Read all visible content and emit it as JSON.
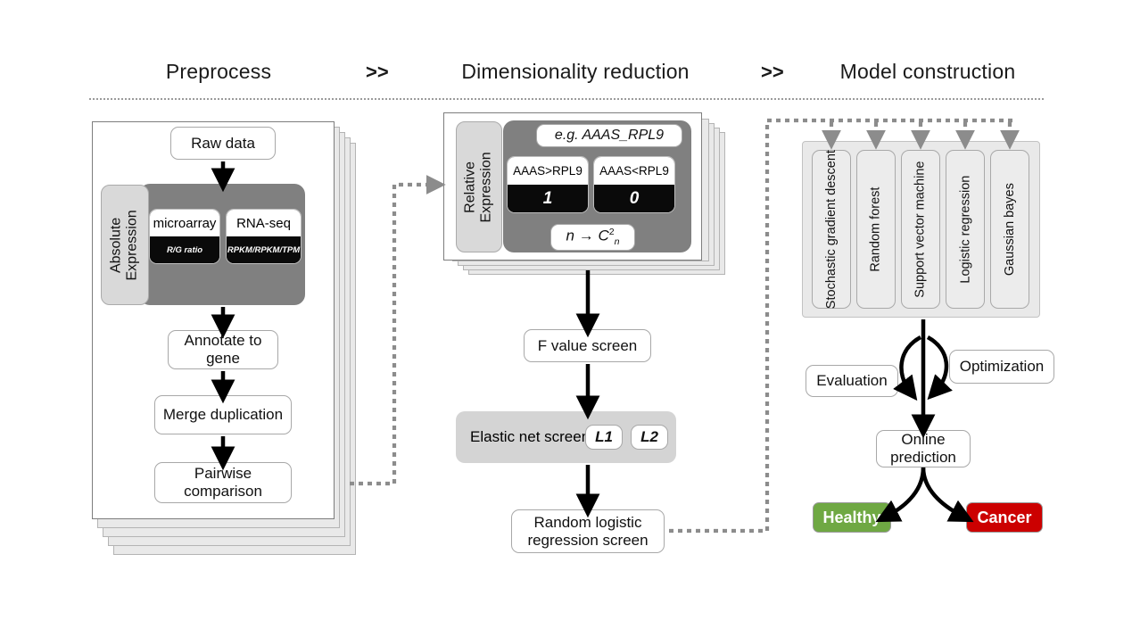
{
  "header": {
    "phases": [
      {
        "label": "Preprocess"
      },
      {
        "label": "Dimensionality reduction"
      },
      {
        "label": "Model construction"
      }
    ],
    "separators": [
      ">>",
      ">>"
    ]
  },
  "preprocess": {
    "raw_data": "Raw data",
    "group_label_line1": "Absolute",
    "group_label_line2": "Expression",
    "platforms": [
      {
        "name": "microarray",
        "metric": "R/G ratio"
      },
      {
        "name": "RNA-seq",
        "metric": "RPKM/RPKM/TPM"
      }
    ],
    "steps": [
      "Annotate to gene",
      "Merge duplication",
      "Pairwise comparison"
    ]
  },
  "dimensionality": {
    "group_label_line1": "Relative",
    "group_label_line2": "Expression",
    "example": "e.g. AAAS_RPL9",
    "comparisons": [
      {
        "condition": "AAAS>RPL9",
        "value": "1"
      },
      {
        "condition": "AAAS<RPL9",
        "value": "0"
      }
    ],
    "formula_base": "n",
    "formula_arrow": "→",
    "formula_symbol": "C",
    "formula_sup": "2",
    "formula_sub": "n",
    "f_value_screen": "F value screen",
    "elastic_net": {
      "label": "Elastic net screen",
      "penalties": [
        "L1",
        "L2"
      ]
    },
    "random_logistic": "Random logistic regression screen"
  },
  "model": {
    "algorithms": [
      "Stochastic gradient descent",
      "Random forest",
      "Support vector machine",
      "Logistic regression",
      "Gaussian bayes"
    ],
    "evaluation": "Evaluation",
    "optimization": "Optimization",
    "online_prediction": "Online prediction",
    "outcomes": [
      {
        "label": "Healthy",
        "color": "#6FA843"
      },
      {
        "label": "Cancer",
        "color": "#CC0000"
      }
    ]
  },
  "colors": {
    "healthy": "#6FA843",
    "cancer": "#CC0000",
    "dark_band": "#808080",
    "gray_band": "#d4d4d4",
    "dotted_line": "#8c8c8c"
  }
}
